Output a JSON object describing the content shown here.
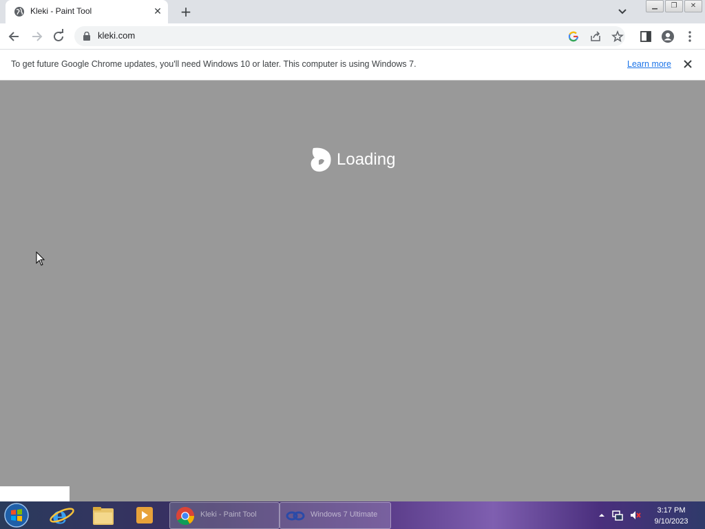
{
  "browser": {
    "tab": {
      "title": "Kleki - Paint Tool",
      "favicon": "globe-icon",
      "close": "close-icon"
    },
    "new_tab": "plus-icon",
    "window_buttons": [
      "minimize-icon",
      "restore-icon",
      "close-icon"
    ],
    "address": {
      "url": "kleki.com"
    },
    "infobar": {
      "message": "To get future Google Chrome updates, you'll need Windows 10 or later. This computer is using Windows 7.",
      "link": "Learn more"
    }
  },
  "page": {
    "loading_text": "Loading",
    "background": "#999999"
  },
  "taskbar": {
    "apps": [
      {
        "name": "start-orb"
      },
      {
        "name": "internet-explorer-icon"
      },
      {
        "name": "file-explorer-icon"
      },
      {
        "name": "media-player-icon"
      }
    ],
    "windows": [
      {
        "label": "Kleki - Paint Tool",
        "icon": "chrome-icon",
        "active": true
      },
      {
        "label": "Windows 7 Ultimate",
        "icon": "virtualbox-icon",
        "active": false
      }
    ],
    "clock": {
      "time": "3:17 PM",
      "date": "9/10/2023"
    }
  }
}
